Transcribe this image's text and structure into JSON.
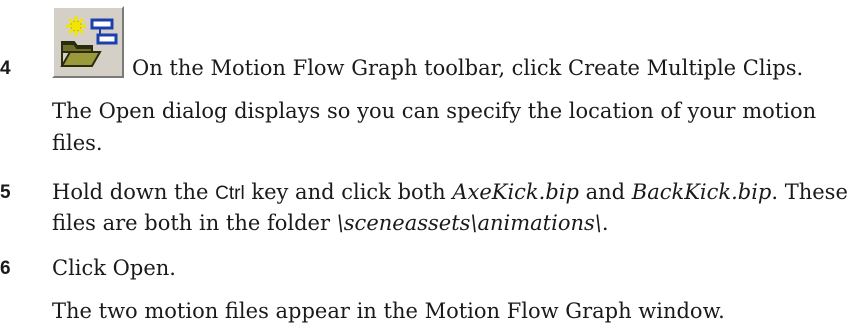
{
  "steps": [
    {
      "number": "4",
      "instruction": "On the Motion Flow Graph toolbar, click Create Multiple Clips.",
      "result_line1": "The Open dialog displays so you can specify the location of your motion",
      "result_line2": "files.",
      "icon": "create-multiple-clips-icon"
    },
    {
      "number": "5",
      "line1_a": "Hold down the ",
      "key": "Ctrl",
      "line1_b": " key and click both ",
      "file1": "AxeKick.bip",
      "line1_c": " and ",
      "file2": "BackKick.bip",
      "line1_d": ". These",
      "line2_a": "files are both in the folder ",
      "folder": "\\sceneassets\\animations\\",
      "line2_b": "."
    },
    {
      "number": "6",
      "instruction": "Click Open.",
      "result": "The two motion files appear in the Motion Flow Graph window."
    }
  ]
}
